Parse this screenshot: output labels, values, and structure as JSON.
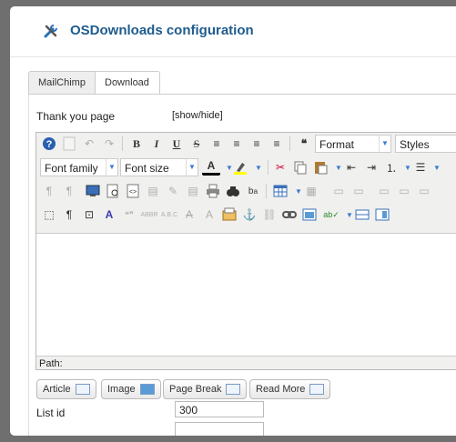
{
  "header": {
    "title": "OSDownloads configuration",
    "icon": "tools-icon"
  },
  "tabs": [
    {
      "label": "MailChimp"
    },
    {
      "label": "Download"
    }
  ],
  "thankyou": {
    "label": "Thank you page",
    "toggle": "[show/hide]"
  },
  "toolbar": {
    "format": "Format",
    "styles": "Styles",
    "font_family": "Font family",
    "font_size": "Font size",
    "letter_a": "A"
  },
  "editor": {
    "path_label": "Path:"
  },
  "insert_buttons": [
    {
      "label": "Article"
    },
    {
      "label": "Image"
    },
    {
      "label": "Page Break"
    },
    {
      "label": "Read More"
    }
  ],
  "list": {
    "label": "List id",
    "value": "300"
  }
}
